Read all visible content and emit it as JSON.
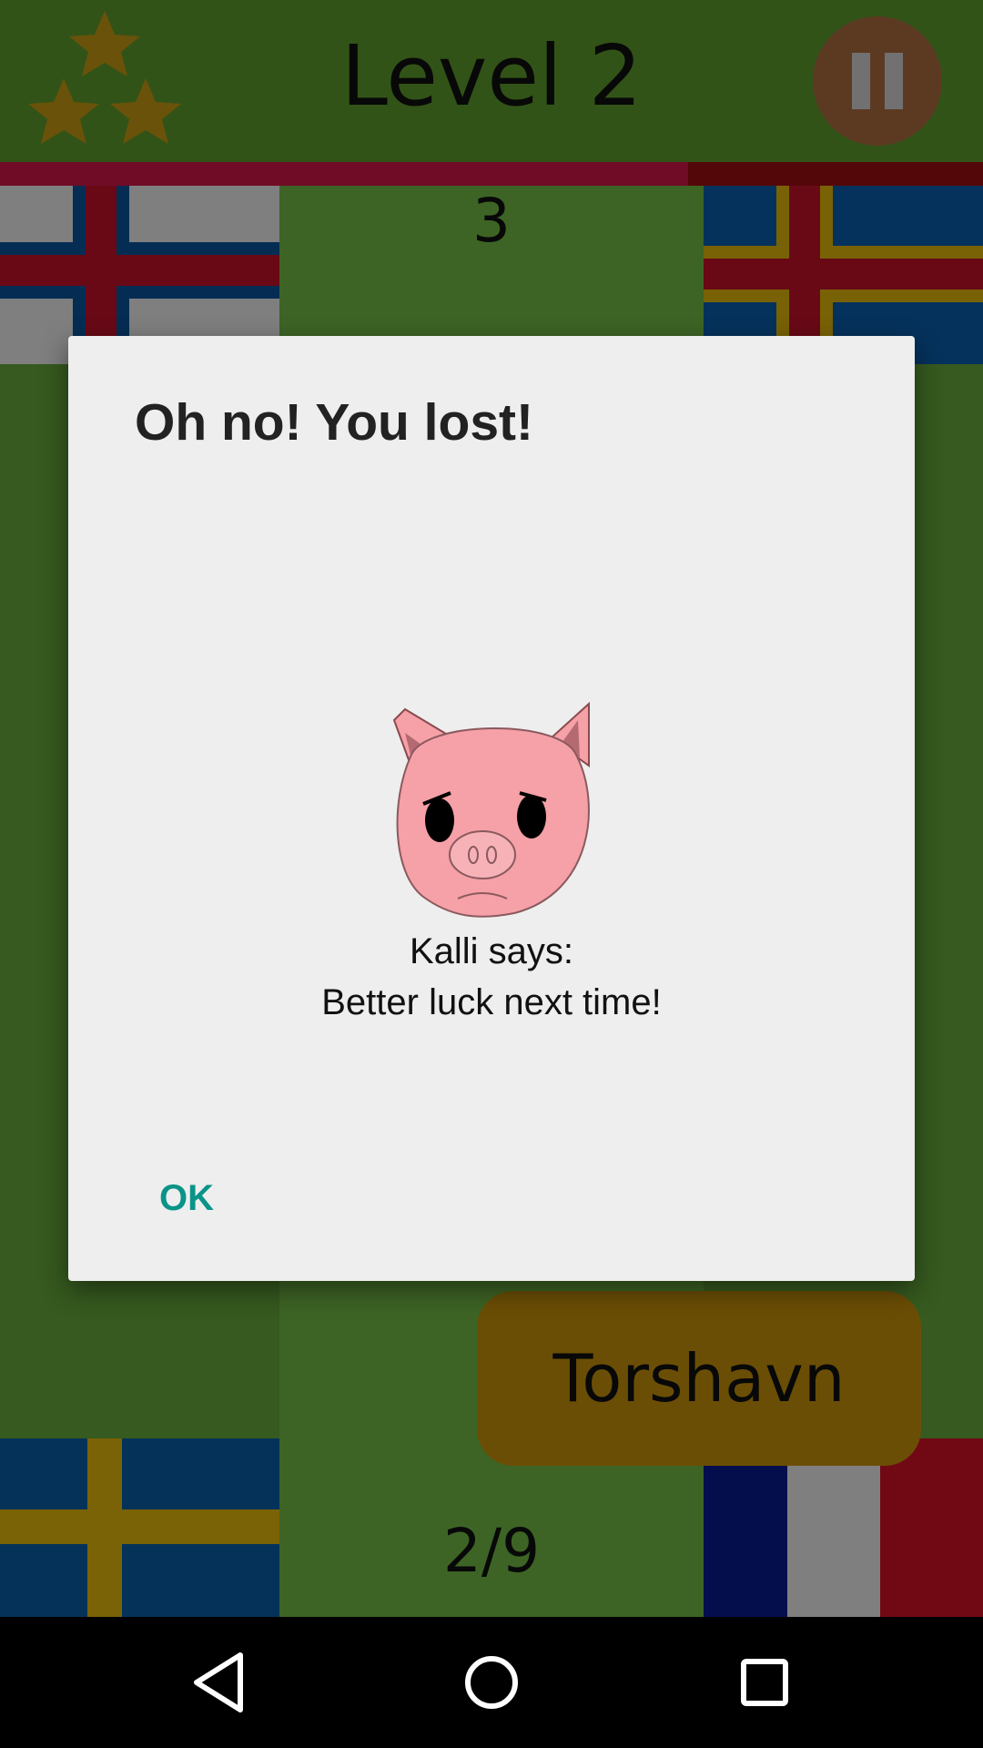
{
  "game": {
    "level_title": "Level 2",
    "question_counter": "3",
    "progress": "2/9",
    "answer_option": "Torshavn",
    "timer_fraction_remaining": 0.7,
    "stars_earned": 3
  },
  "flags": [
    {
      "name": "faroe-islands-flag"
    },
    {
      "name": "aland-islands-flag"
    },
    {
      "name": "sweden-flag"
    },
    {
      "name": "france-flag"
    }
  ],
  "dialog": {
    "title": "Oh no! You lost!",
    "speaker_line": "Kalli says:",
    "message": "Better luck next time!",
    "ok_label": "OK",
    "mascot": "sad-pig-icon"
  },
  "navbar": {
    "buttons": [
      "back-icon",
      "home-icon",
      "recents-icon"
    ]
  },
  "colors": {
    "background_green": "#6cb43f",
    "timer_red": "#a80e10",
    "answer_gold": "#d79c0a",
    "dialog_bg": "#eeeeee",
    "accent_teal": "#0a9488"
  }
}
